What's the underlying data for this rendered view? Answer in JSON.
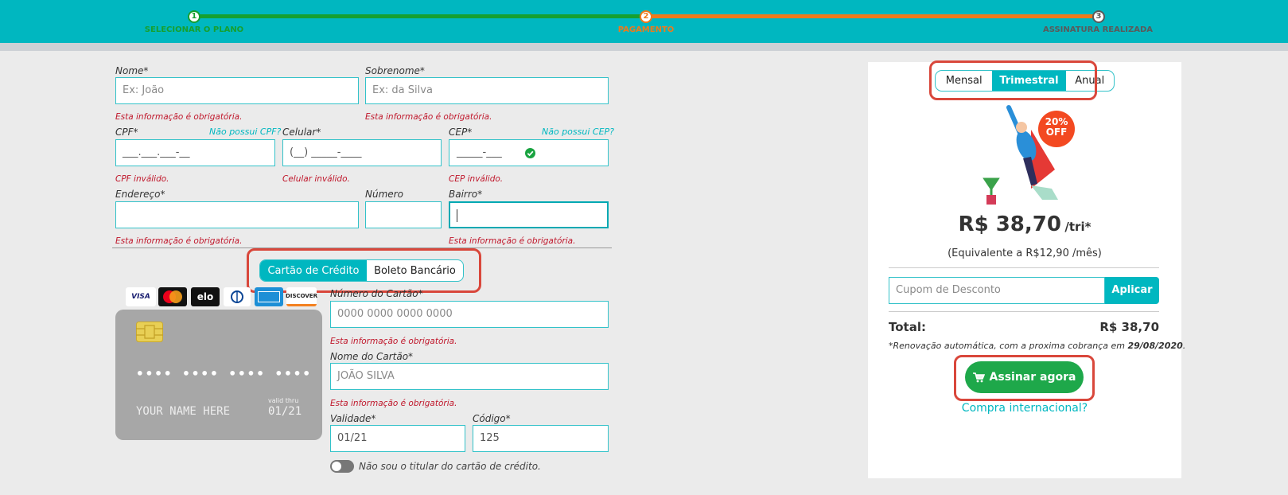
{
  "progress": {
    "steps": [
      {
        "num": "1",
        "label": "SELECIONAR O PLANO"
      },
      {
        "num": "2",
        "label": "PAGAMENTO"
      },
      {
        "num": "3",
        "label": "ASSINATURA REALIZADA"
      }
    ],
    "colors": {
      "done": "#16a02f",
      "current": "#ef7a1a",
      "pending": "#5a5a5a",
      "bar": "#00b7c0"
    }
  },
  "form": {
    "nome": {
      "label": "Nome*",
      "placeholder": "Ex: João",
      "error": "Esta informação é obrigatória."
    },
    "sobrenome": {
      "label": "Sobrenome*",
      "placeholder": "Ex: da Silva",
      "error": "Esta informação é obrigatória."
    },
    "cpf": {
      "label": "CPF*",
      "link": "Não possui CPF?",
      "value": "___.___.___-__",
      "error": "CPF inválido."
    },
    "celular": {
      "label": "Celular*",
      "value": "(__) _____-____",
      "error": "Celular inválido."
    },
    "cep": {
      "label": "CEP*",
      "link": "Não possui CEP?",
      "value": "_____-___",
      "error": "CEP inválido."
    },
    "endereco": {
      "label": "Endereço*",
      "error": "Esta informação é obrigatória."
    },
    "numero": {
      "label": "Número"
    },
    "bairro": {
      "label": "Bairro*",
      "error": "Esta informação é obrigatória."
    }
  },
  "payment": {
    "tabs": [
      "Cartão de Crédito",
      "Boleto Bancário"
    ],
    "active_tab": "Cartão de Crédito",
    "brands": [
      "VISA",
      "MasterCard",
      "elo",
      "Diners Club",
      "American Express",
      "DISCOVER"
    ],
    "card_preview": {
      "number": "•••• •••• •••• ••••",
      "name": "YOUR NAME HERE",
      "valid_label": "valid thru",
      "valid": "01/21"
    },
    "card_number": {
      "label": "Número do Cartão*",
      "placeholder": "0000 0000 0000 0000",
      "error": "Esta informação é obrigatória."
    },
    "card_name": {
      "label": "Nome do Cartão*",
      "placeholder": "JOÃO SILVA",
      "error": "Esta informação é obrigatória."
    },
    "validity": {
      "label": "Validade*",
      "value": "01/21"
    },
    "code": {
      "label": "Código*",
      "value": "125"
    },
    "not_holder": "Não sou o titular do cartão de crédito."
  },
  "plan": {
    "periods": [
      "Mensal",
      "Trimestral",
      "Anual"
    ],
    "active_period": "Trimestral",
    "badge": [
      "20%",
      "OFF"
    ],
    "price": "R$ 38,70",
    "price_unit": "/tri*",
    "equivalent": "(Equivalente a R$12,90 /mês)",
    "coupon_placeholder": "Cupom de Desconto",
    "apply_label": "Aplicar",
    "total_label": "Total:",
    "total_value": "R$ 38,70",
    "renewal_text": "*Renovação automática, com a proxima cobrança em ",
    "renewal_date": "29/08/2020",
    "subscribe_label": "Assinar agora",
    "international_link": "Compra internacional?"
  }
}
